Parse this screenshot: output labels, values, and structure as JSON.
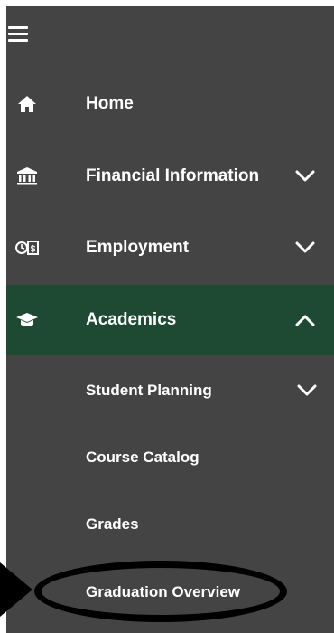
{
  "nav": {
    "menu_icon": "hamburger-menu-icon",
    "items": [
      {
        "label": "Home",
        "icon": "home-icon",
        "expandable": false
      },
      {
        "label": "Financial Information",
        "icon": "bank-icon",
        "expandable": true,
        "expanded": false
      },
      {
        "label": "Employment",
        "icon": "timecard-dollar-icon",
        "expandable": true,
        "expanded": false
      },
      {
        "label": "Academics",
        "icon": "graduation-cap-icon",
        "expandable": true,
        "expanded": true,
        "active": true
      }
    ],
    "academics_subitems": [
      {
        "label": "Student Planning",
        "expandable": true,
        "expanded": false
      },
      {
        "label": "Course Catalog"
      },
      {
        "label": "Grades"
      },
      {
        "label": "Graduation Overview",
        "highlighted": true
      }
    ]
  },
  "colors": {
    "nav_background": "#444444",
    "active_background": "#1e4a33",
    "text": "#ffffff",
    "annotation": "#000000"
  }
}
